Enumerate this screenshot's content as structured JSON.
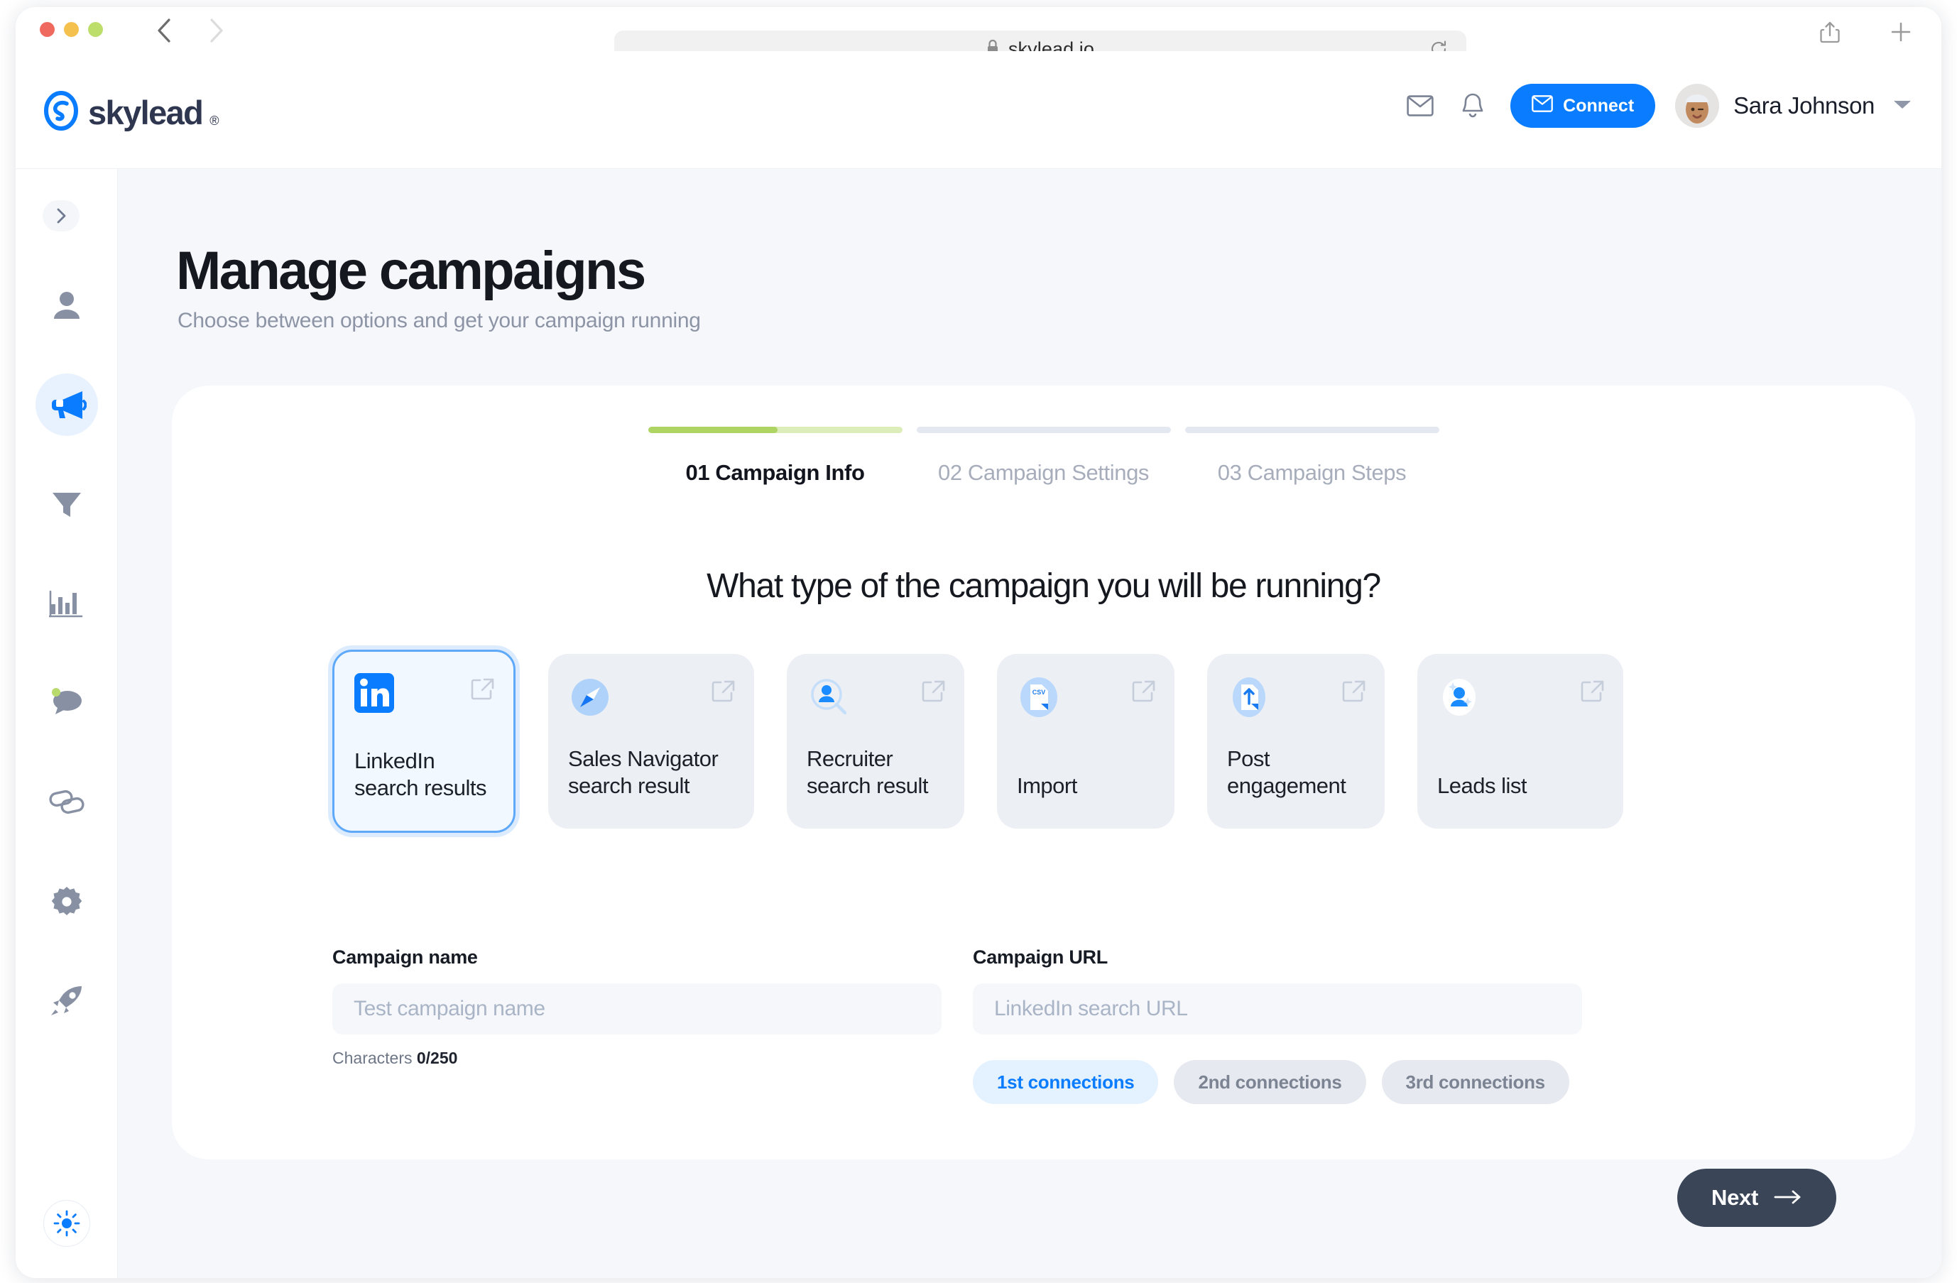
{
  "browser": {
    "url": "skylead.io",
    "back_label": "Back",
    "forward_label": "Forward",
    "reload_label": "Reload",
    "share_label": "Share",
    "new_tab_label": "New Tab"
  },
  "header": {
    "logo_text": "skylead",
    "logo_registered": "®",
    "mail_label": "Messages",
    "bell_label": "Notifications",
    "connect_label": "Connect",
    "username": "Sara Johnson",
    "avatar_emoji": "🙂"
  },
  "sidebar": {
    "toggle_label": "Expand sidebar",
    "items": [
      {
        "name": "contacts",
        "label": "Contacts",
        "active": false
      },
      {
        "name": "campaigns",
        "label": "Campaigns",
        "active": true
      },
      {
        "name": "filters",
        "label": "Filters",
        "active": false
      },
      {
        "name": "analytics",
        "label": "Analytics",
        "active": false
      },
      {
        "name": "inbox",
        "label": "Inbox",
        "active": false
      },
      {
        "name": "integrations",
        "label": "Integrations",
        "active": false
      },
      {
        "name": "settings",
        "label": "Settings",
        "active": false
      },
      {
        "name": "whats-new",
        "label": "What's new",
        "active": false
      }
    ],
    "theme_label": "Theme"
  },
  "page": {
    "title": "Manage campaigns",
    "subtitle": "Choose between options and get your campaign running"
  },
  "stepper": {
    "steps": [
      {
        "label": "01 Campaign Info",
        "active": true,
        "progress": 51
      },
      {
        "label": "02 Campaign Settings",
        "active": false,
        "progress": 0
      },
      {
        "label": "03 Campaign Steps",
        "active": false,
        "progress": 0
      }
    ]
  },
  "question": "What type of the campaign you will be running?",
  "campaign_types": [
    {
      "label": "LinkedIn\nsearch results",
      "icon": "linkedin-icon",
      "selected": true
    },
    {
      "label": "Sales Navigator\nsearch result",
      "icon": "compass-icon",
      "selected": false
    },
    {
      "label": "Recruiter\nsearch result",
      "icon": "person-search-icon",
      "selected": false
    },
    {
      "label": "Import",
      "icon": "csv-file-icon",
      "selected": false
    },
    {
      "label": "Post\nengagement",
      "icon": "upload-file-icon",
      "selected": false
    },
    {
      "label": "Leads list",
      "icon": "person-sparkle-icon",
      "selected": false
    }
  ],
  "form": {
    "campaign_name": {
      "label": "Campaign name",
      "value": "",
      "placeholder": "Test campaign name",
      "char_prefix": "Characters ",
      "char_value": "0/250"
    },
    "campaign_url": {
      "label": "Campaign URL",
      "value": "",
      "placeholder": "LinkedIn search URL"
    },
    "connections": [
      {
        "label": "1st connections",
        "active": true
      },
      {
        "label": "2nd connections",
        "active": false
      },
      {
        "label": "3rd connections",
        "active": false
      }
    ]
  },
  "footer": {
    "next_label": "Next"
  },
  "colors": {
    "accent_blue": "#0a7cff",
    "progress_green": "#aed464",
    "progress_green_light": "#dcedb9",
    "page_bg": "#f5f7fb",
    "card_bg": "#eceff4",
    "next_btn": "#3a4558"
  }
}
